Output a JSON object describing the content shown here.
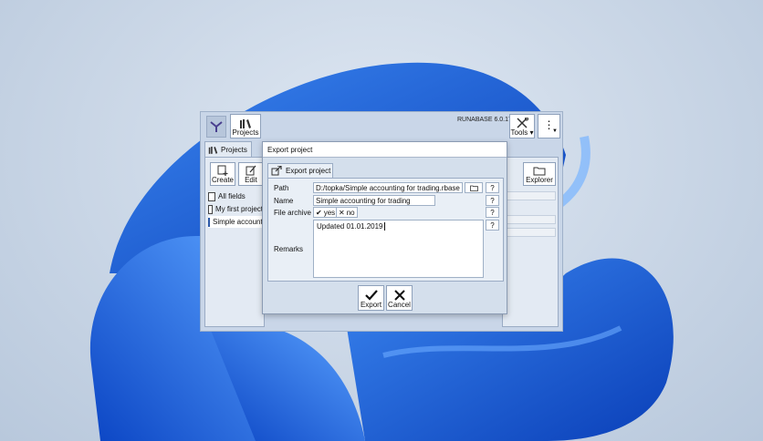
{
  "app": {
    "version": "RUNABASE 6.0.17",
    "toolbar": {
      "projects_label": "Projects",
      "tools_label": "Tools",
      "more_label": "⋮"
    },
    "tab_projects": "Projects",
    "left_buttons": {
      "create": "Create",
      "edit": "Edit"
    },
    "project_list": [
      {
        "label": "All fields",
        "icon": "document-icon"
      },
      {
        "label": "My first project",
        "icon": "document-icon"
      },
      {
        "label": "Simple accounting for trading",
        "icon": "database-file-icon",
        "selected": true
      }
    ],
    "explorer_label": "Explorer"
  },
  "dialog": {
    "title": "Export project",
    "tab_label": "Export project",
    "path": {
      "label": "Path",
      "value": "D:/topka/Simple accounting for trading.rbase"
    },
    "name": {
      "label": "Name",
      "value": "Simple accounting for trading"
    },
    "file_archive": {
      "label": "File archive",
      "yes": "yes",
      "no": "no",
      "selected": "yes"
    },
    "remarks": {
      "label": "Remarks",
      "value": "Updated 01.01.2019"
    },
    "help_label": "?",
    "export_label": "Export",
    "cancel_label": "Cancel"
  },
  "colors": {
    "accent": "#1a5fd6",
    "window_bg": "#c9d6e8",
    "panel_bg": "#e3eaf3"
  }
}
